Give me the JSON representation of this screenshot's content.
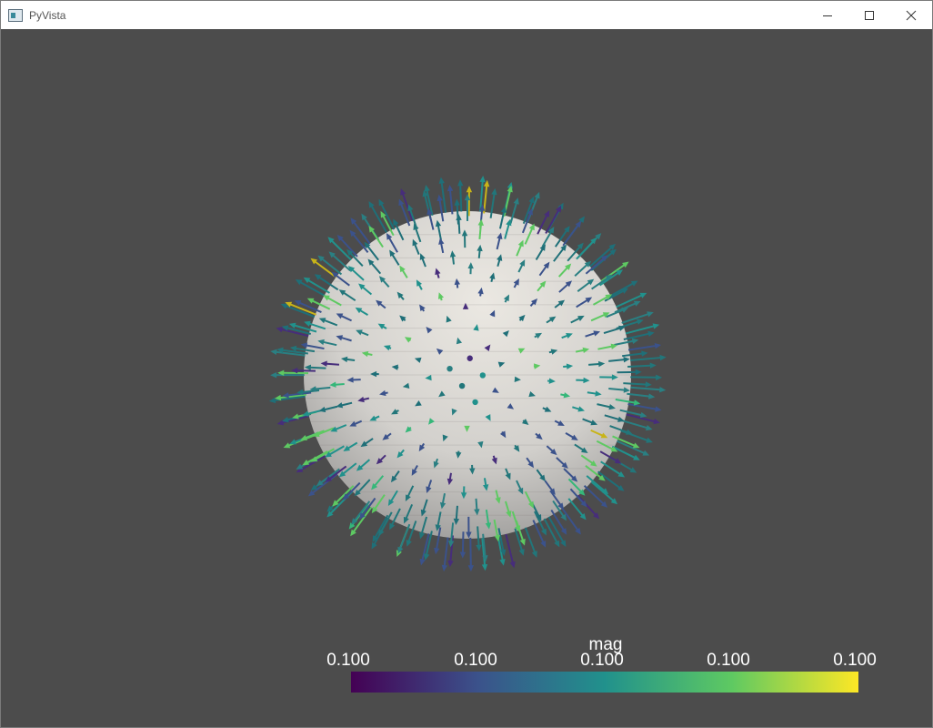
{
  "window": {
    "title": "PyVista",
    "controls": {
      "minimize_icon": "minimize-icon",
      "maximize_icon": "maximize-icon",
      "close_icon": "close-icon"
    }
  },
  "scene": {
    "background_color": "#4c4c4c",
    "sphere_color": "#e6e3de",
    "glyph_type": "arrows",
    "dominant_arrow_color": "#22767a"
  },
  "scalar_bar": {
    "title": "mag",
    "tick_labels": [
      "0.100",
      "0.100",
      "0.100",
      "0.100",
      "0.100"
    ],
    "colormap": "viridis",
    "colors": [
      "#440154",
      "#3b528b",
      "#21918c",
      "#5ec962",
      "#fde725"
    ]
  }
}
